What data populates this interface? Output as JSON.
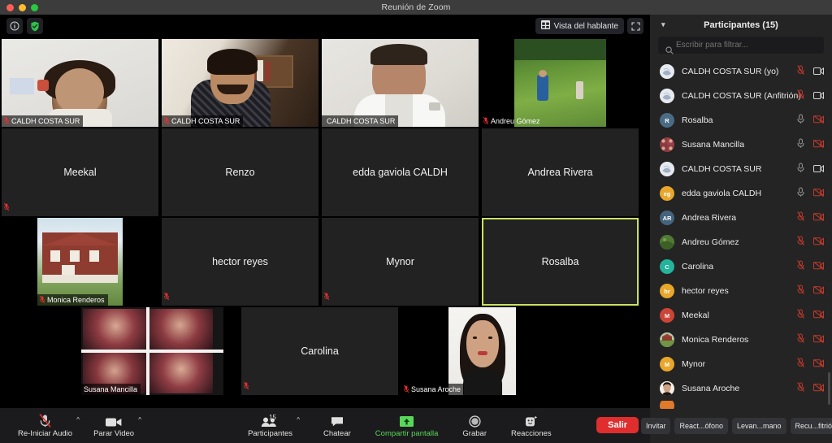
{
  "window": {
    "title": "Reunión de Zoom",
    "traffic_lights": [
      "close",
      "minimize",
      "maximize"
    ]
  },
  "topbar": {
    "info_icon": "info-icon",
    "encryption_icon": "shield-check-icon",
    "view_button_label": "Vista del hablante",
    "view_button_icon": "grid-view-icon",
    "fullscreen_icon": "fullscreen-icon"
  },
  "grid": {
    "rows": 4,
    "cols": 4,
    "active_speaker": "Rosalba",
    "active_border_color": "#c9e265",
    "tiles": [
      {
        "name": "CALDH COSTA SUR",
        "video": true,
        "muted": true,
        "label_style": "bar",
        "cam": "woman-white-wall"
      },
      {
        "name": "CALDH COSTA SUR",
        "video": true,
        "muted": true,
        "label_style": "bar",
        "cam": "man-bookshelf"
      },
      {
        "name": "CALDH COSTA SUR",
        "video": true,
        "muted": false,
        "label_style": "bar",
        "cam": "man-white-shirt"
      },
      {
        "name": "Andreu Gómez",
        "video": true,
        "muted": true,
        "label_style": "plain",
        "cam": "field-photographer"
      },
      {
        "name": "Meekal",
        "video": false,
        "muted": true,
        "label_style": "center",
        "cam": ""
      },
      {
        "name": "Renzo",
        "video": false,
        "muted": false,
        "label_style": "center",
        "cam": ""
      },
      {
        "name": "edda gaviola CALDH",
        "video": false,
        "muted": true,
        "label_style": "center",
        "cam": ""
      },
      {
        "name": "Andrea Rivera",
        "video": false,
        "muted": true,
        "label_style": "center",
        "cam": ""
      },
      {
        "name": "Monica Renderos",
        "video": true,
        "muted": true,
        "label_style": "bar",
        "cam": "red-house"
      },
      {
        "name": "hector reyes",
        "video": false,
        "muted": true,
        "label_style": "center",
        "cam": ""
      },
      {
        "name": "Mynor",
        "video": false,
        "muted": true,
        "label_style": "center",
        "cam": ""
      },
      {
        "name": "Rosalba",
        "video": false,
        "muted": false,
        "label_style": "center",
        "cam": "",
        "active": true
      },
      {
        "name": "Susana Mancilla",
        "video": true,
        "muted": false,
        "label_style": "bar",
        "cam": "collage-redhair"
      },
      {
        "name": "Carolina",
        "video": false,
        "muted": true,
        "label_style": "center",
        "cam": ""
      },
      {
        "name": "Susana Aroche",
        "video": true,
        "muted": true,
        "label_style": "bar",
        "cam": "woman-portrait"
      }
    ]
  },
  "toolbar": {
    "audio": {
      "label": "Re-Iniciar Audio",
      "icon": "mic-muted-icon",
      "has_caret": true
    },
    "video": {
      "label": "Parar Video",
      "icon": "camera-icon",
      "has_caret": true
    },
    "participants": {
      "label": "Participantes",
      "icon": "people-icon",
      "count": "15",
      "has_caret": true
    },
    "chat": {
      "label": "Chatear",
      "icon": "chat-bubble-icon"
    },
    "share": {
      "label": "Compartir pantalla",
      "icon": "share-screen-icon",
      "accent": "#5ad65a"
    },
    "record": {
      "label": "Grabar",
      "icon": "record-circle-icon"
    },
    "reactions": {
      "label": "Reacciones",
      "icon": "smiley-icon"
    },
    "leave": {
      "label": "Salir",
      "color": "#e02d2d"
    }
  },
  "panel": {
    "title": "Participantes (15)",
    "collapse_icon": "chevron-down-icon",
    "search_placeholder": "Escribir para filtrar...",
    "search_value": "",
    "search_icon": "search-icon",
    "participants": [
      {
        "name": "CALDH COSTA SUR (yo)",
        "avatar_type": "image",
        "avatar_text": "",
        "avatar_color": "#dfe3ea",
        "mic": "muted",
        "video": "on"
      },
      {
        "name": "CALDH COSTA SUR (Anfitrión)",
        "avatar_type": "image",
        "avatar_text": "",
        "avatar_color": "#dfe3ea",
        "mic": "muted",
        "video": "on"
      },
      {
        "name": "Rosalba",
        "avatar_type": "initials",
        "avatar_text": "R",
        "avatar_color": "#4a6b85",
        "mic": "on",
        "video": "off"
      },
      {
        "name": "Susana Mancilla",
        "avatar_type": "image",
        "avatar_text": "",
        "avatar_color": "#7d2b2b",
        "mic": "on",
        "video": "off"
      },
      {
        "name": "CALDH COSTA SUR",
        "avatar_type": "image",
        "avatar_text": "",
        "avatar_color": "#dfe3ea",
        "mic": "on",
        "video": "on"
      },
      {
        "name": "edda gaviola CALDH",
        "avatar_type": "initials",
        "avatar_text": "eg",
        "avatar_color": "#e8a72b",
        "mic": "on",
        "video": "off"
      },
      {
        "name": "Andrea Rivera",
        "avatar_type": "initials",
        "avatar_text": "AR",
        "avatar_color": "#44637d",
        "mic": "muted",
        "video": "off"
      },
      {
        "name": "Andreu Gómez",
        "avatar_type": "image",
        "avatar_text": "",
        "avatar_color": "#4a6b3a",
        "mic": "muted",
        "video": "off"
      },
      {
        "name": "Carolina",
        "avatar_type": "initials",
        "avatar_text": "C",
        "avatar_color": "#24b39b",
        "mic": "muted",
        "video": "off"
      },
      {
        "name": "hector reyes",
        "avatar_type": "initials",
        "avatar_text": "hr",
        "avatar_color": "#e8a72b",
        "mic": "muted",
        "video": "off"
      },
      {
        "name": "Meekal",
        "avatar_type": "initials",
        "avatar_text": "M",
        "avatar_color": "#cc4436",
        "mic": "muted",
        "video": "off"
      },
      {
        "name": "Monica Renderos",
        "avatar_type": "image",
        "avatar_text": "",
        "avatar_color": "#6b7a5a",
        "mic": "muted",
        "video": "off"
      },
      {
        "name": "Mynor",
        "avatar_type": "initials",
        "avatar_text": "M",
        "avatar_color": "#e8a72b",
        "mic": "muted",
        "video": "off"
      },
      {
        "name": "Susana Aroche",
        "avatar_type": "image",
        "avatar_text": "",
        "avatar_color": "#c8b0a0",
        "mic": "muted",
        "video": "off"
      },
      {
        "name": "",
        "avatar_type": "image",
        "avatar_text": "",
        "avatar_color": "#e07a2b",
        "mic": "",
        "video": ""
      }
    ],
    "footer_buttons": [
      {
        "label": "Invitar"
      },
      {
        "label": "React...ófono"
      },
      {
        "label": "Levan...mano"
      },
      {
        "label": "Recu...fitrión"
      }
    ]
  },
  "colors": {
    "accent_green": "#5ad65a",
    "active_speaker": "#c9e265",
    "leave_red": "#e02d2d",
    "panel_bg": "#242424",
    "toolbar_bg": "#1b1b1d"
  }
}
